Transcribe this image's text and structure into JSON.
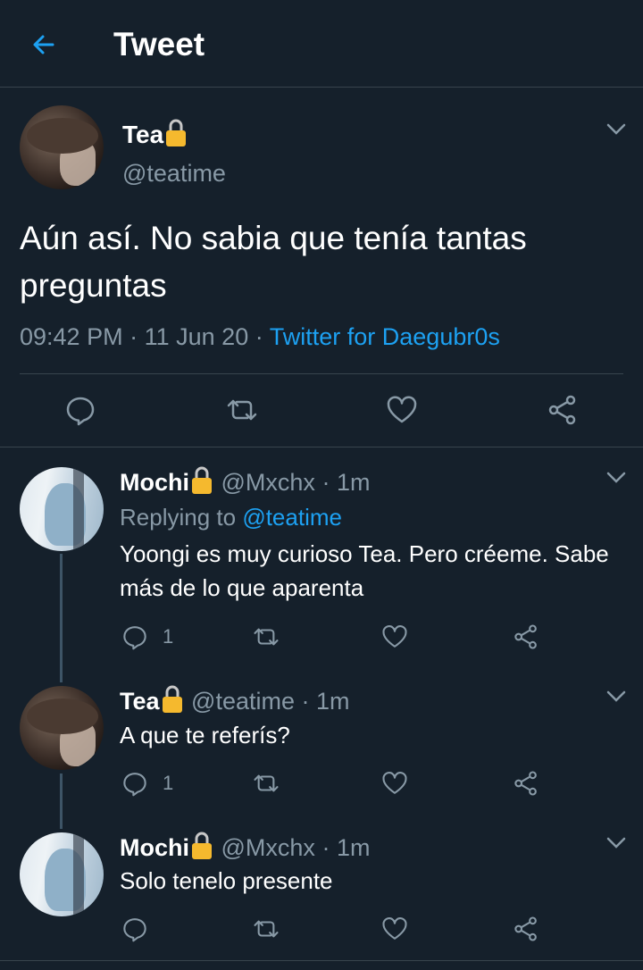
{
  "header": {
    "title": "Tweet",
    "back_icon": "arrow-left-icon"
  },
  "colors": {
    "background": "#15202b",
    "accent": "#1da1f2",
    "muted": "#8899a6",
    "divider": "#38444d",
    "lock": "#f5b92e"
  },
  "main_tweet": {
    "name": "Tea",
    "handle": "@teatime",
    "text": "Aún así. No sabia que tenía tantas preguntas",
    "time": "09:42 PM",
    "date": "11 Jun 20",
    "separator": "·",
    "source": "Twitter for Daegubr0s"
  },
  "replies": [
    {
      "name": "Mochi",
      "handle": "@Mxchx",
      "time": "1m",
      "replying_label": "Replying to",
      "replying_to": "@teatime",
      "text": "Yoongi es muy curioso Tea. Pero créeme. Sabe más de lo que aparenta",
      "reply_count": "1"
    },
    {
      "name": "Tea",
      "handle": "@teatime",
      "time": "1m",
      "text": "A que te referís?",
      "reply_count": "1"
    },
    {
      "name": "Mochi",
      "handle": "@Mxchx",
      "time": "1m",
      "text": "Solo tenelo presente",
      "reply_count": ""
    }
  ]
}
